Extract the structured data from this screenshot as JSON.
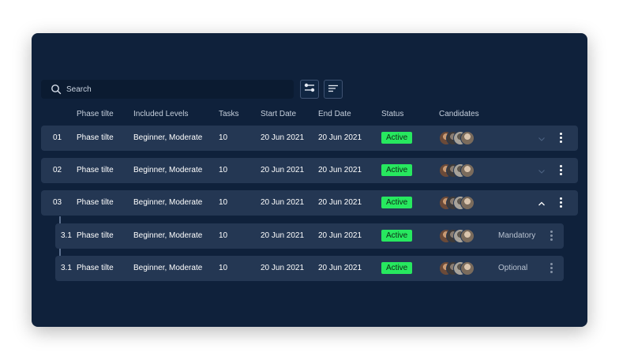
{
  "search": {
    "placeholder": "Search",
    "icon": "search-icon"
  },
  "toolbar": {
    "filter_icon": "filter-toggle-icon",
    "sort_icon": "sort-lines-icon"
  },
  "columns": {
    "phase": "Phase tilte",
    "levels": "Included Levels",
    "tasks": "Tasks",
    "start": "Start Date",
    "end": "End Date",
    "status": "Status",
    "candidates": "Candidates"
  },
  "rows": [
    {
      "num": "01",
      "phase": "Phase tilte",
      "levels": "Beginner, Moderate",
      "tasks": "10",
      "start": "20 Jun 2021",
      "end": "20 Jun 2021",
      "status": "Active",
      "expanded": false
    },
    {
      "num": "02",
      "phase": "Phase tilte",
      "levels": "Beginner, Moderate",
      "tasks": "10",
      "start": "20 Jun 2021",
      "end": "20 Jun 2021",
      "status": "Active",
      "expanded": false
    },
    {
      "num": "03",
      "phase": "Phase tilte",
      "levels": "Beginner, Moderate",
      "tasks": "10",
      "start": "20 Jun 2021",
      "end": "20 Jun 2021",
      "status": "Active",
      "expanded": true
    }
  ],
  "subrows": [
    {
      "num": "3.1",
      "phase": "Phase tilte",
      "levels": "Beginner, Moderate",
      "tasks": "10",
      "start": "20 Jun 2021",
      "end": "20 Jun 2021",
      "status": "Active",
      "type": "Mandatory"
    },
    {
      "num": "3.1",
      "phase": "Phase tilte",
      "levels": "Beginner, Moderate",
      "tasks": "10",
      "start": "20 Jun 2021",
      "end": "20 Jun 2021",
      "status": "Active",
      "type": "Optional"
    }
  ],
  "colors": {
    "panel": "#0f213b",
    "row": "#243753",
    "status_active": "#27e85f",
    "text": "#ffffff"
  }
}
